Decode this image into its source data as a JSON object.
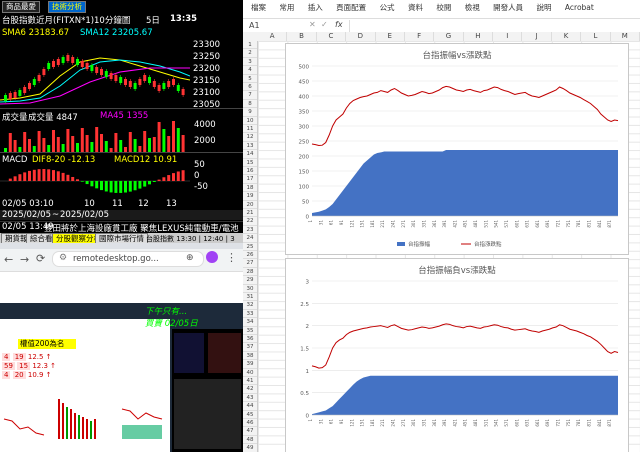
{
  "stock": {
    "tab1": "商品最愛",
    "tab2": "技術分析",
    "instrument": "台股指數近月(FITXN*1)",
    "interval": "10分鐘圖",
    "days": "5日",
    "time": "13:35",
    "sma6": "SMA6 23183.67",
    "sma12": "SMA12 23205.67",
    "price_ticks": [
      "23300",
      "23250",
      "23200",
      "23150",
      "23100",
      "23050"
    ],
    "vol_label": "成交量",
    "vol_value": "成交量 4847",
    "ma45": "MA45 1355",
    "vol_ticks": [
      "4000",
      "2000"
    ],
    "macd_label": "MACD",
    "dif": "DIF8-20 -12.13",
    "macd12": "MACD12 10.91",
    "macd_ticks": [
      "50",
      "0",
      "-50"
    ],
    "x_ticks": [
      "02/05 03:10",
      "10",
      "11",
      "12",
      "13"
    ],
    "date_from": "2025/02/05",
    "date_to": "2025/02/05",
    "news_time": "02/05 13:49",
    "news_text": "豐田將於上海設廠貫工廠 聚焦LEXUS純電動車/電池",
    "bottom_tabs": [
      "期貨報價",
      "綜合看盤",
      "分股觀察分析",
      "國際市場行情"
    ],
    "bottom_status": "台股指數 13:30 | 12:40 | 3"
  },
  "browser": {
    "url": "remotedesktop.go..."
  },
  "desktop": {
    "header": "權值200為名",
    "rows": [
      {
        "a": "4",
        "b": "19",
        "c": "12.5 ↑"
      },
      {
        "a": "59",
        "b": "15",
        "c": "12.3 ↑"
      },
      {
        "a": "4",
        "b": "20",
        "c": "10.9 ↑"
      }
    ],
    "overlay1": "下午只有...",
    "overlay2": "買賣 02/05日"
  },
  "excel": {
    "menu": [
      "檔案",
      "常用",
      "插入",
      "頁面配置",
      "公式",
      "資料",
      "校閱",
      "檢視",
      "開發人員",
      "說明",
      "Acrobat"
    ],
    "name_box": "A1",
    "formula_icon": "fx",
    "columns": [
      "A",
      "B",
      "C",
      "D",
      "E",
      "F",
      "G",
      "H",
      "I",
      "J",
      "K",
      "L",
      "M"
    ],
    "row_numbers": [
      "1",
      "2",
      "3",
      "4",
      "5",
      "6",
      "7",
      "8",
      "9",
      "10",
      "11",
      "12",
      "13",
      "14",
      "15",
      "16",
      "17",
      "18",
      "19",
      "20",
      "21",
      "22",
      "23",
      "24",
      "25",
      "26",
      "27",
      "28",
      "29",
      "30",
      "31",
      "32",
      "33",
      "34",
      "35",
      "36",
      "37",
      "38",
      "39",
      "40",
      "41",
      "42",
      "43",
      "44",
      "45",
      "46",
      "47",
      "48",
      "49"
    ],
    "accent": "#4472c4",
    "line_color": "#c00000"
  },
  "chart_data": [
    {
      "type": "line",
      "title": "台指振幅vs漲跌點",
      "ylim": [
        0,
        500
      ],
      "yticks": [
        0,
        50,
        100,
        150,
        200,
        250,
        300,
        350,
        400,
        450,
        500
      ],
      "series": [
        {
          "name": "台指振幅",
          "kind": "area",
          "values": [
            10,
            12,
            14,
            18,
            22,
            30,
            40,
            55,
            70,
            85,
            100,
            115,
            130,
            145,
            160,
            175,
            185,
            195,
            205,
            210,
            212,
            215,
            215,
            215,
            215,
            215,
            215,
            215,
            215,
            215,
            215,
            215,
            215,
            215,
            215,
            215,
            215,
            215,
            215,
            220,
            220,
            220,
            220,
            220,
            220,
            220,
            220,
            220,
            220,
            220,
            220,
            220,
            220,
            220,
            220,
            220,
            220,
            220,
            220,
            220,
            220,
            220,
            220,
            220,
            220,
            220,
            220,
            220,
            220,
            220,
            220,
            220,
            220,
            220,
            220,
            220,
            220,
            220,
            220,
            220,
            220,
            220,
            220,
            220,
            220,
            220,
            220,
            220,
            220,
            220
          ]
        },
        {
          "name": "台指漲跌點",
          "kind": "line",
          "values": [
            240,
            238,
            235,
            236,
            245,
            270,
            300,
            320,
            330,
            340,
            360,
            375,
            385,
            390,
            395,
            398,
            400,
            405,
            410,
            412,
            418,
            415,
            412,
            420,
            425,
            418,
            410,
            405,
            400,
            402,
            405,
            410,
            415,
            412,
            408,
            410,
            415,
            420,
            428,
            432,
            430,
            425,
            420,
            418,
            415,
            420,
            422,
            418,
            415,
            412,
            418,
            420,
            425,
            430,
            428,
            422,
            418,
            415,
            410,
            405,
            408,
            410,
            412,
            405,
            400,
            398,
            395,
            400,
            405,
            410,
            415,
            420,
            430,
            425,
            418,
            410,
            405,
            400,
            395,
            388,
            382,
            375,
            365,
            355,
            340,
            330,
            320,
            315,
            320,
            318
          ]
        }
      ],
      "legend": [
        "台指振幅",
        "台指漲跌點"
      ],
      "legend_position": "bottom"
    },
    {
      "type": "line",
      "title": "台指振幅負vs漲跌點",
      "ylim": [
        0,
        3
      ],
      "yticks": [
        0,
        0.5,
        1,
        1.5,
        2,
        2.5,
        3
      ],
      "ylabels": [
        "0",
        "0.5",
        "1",
        "1.5",
        "2",
        "2.5",
        "3"
      ],
      "series": [
        {
          "name": "台指振幅",
          "kind": "area",
          "values": [
            0.02,
            0.04,
            0.06,
            0.08,
            0.1,
            0.15,
            0.2,
            0.28,
            0.36,
            0.44,
            0.52,
            0.6,
            0.68,
            0.75,
            0.8,
            0.84,
            0.86,
            0.88,
            0.88,
            0.88,
            0.88,
            0.88,
            0.88,
            0.88,
            0.88,
            0.88,
            0.88,
            0.88,
            0.88,
            0.88,
            0.88,
            0.88,
            0.88,
            0.88,
            0.88,
            0.88,
            0.88,
            0.88,
            0.88,
            0.88,
            0.88,
            0.88,
            0.88,
            0.88,
            0.88,
            0.88,
            0.88,
            0.88,
            0.88,
            0.88,
            0.88,
            0.88,
            0.88,
            0.88,
            0.88,
            0.88,
            0.88,
            0.88,
            0.88,
            0.88,
            0.88,
            0.88,
            0.88,
            0.88,
            0.88,
            0.88,
            0.88,
            0.88,
            0.88,
            0.88,
            0.88,
            0.88,
            0.88,
            0.88,
            0.88,
            0.88,
            0.88,
            0.88,
            0.88,
            0.88,
            0.88,
            0.88,
            0.88,
            0.88,
            0.88,
            0.88,
            0.88,
            0.88,
            0.88,
            0.88
          ]
        },
        {
          "name": "台指漲跌點",
          "kind": "line",
          "values": [
            1.1,
            1.08,
            1.05,
            1.06,
            1.12,
            1.3,
            1.5,
            1.62,
            1.68,
            1.72,
            1.8,
            1.85,
            1.88,
            1.9,
            1.92,
            1.94,
            1.95,
            1.97,
            1.98,
            1.99,
            2.0,
            1.98,
            1.96,
            2.0,
            2.02,
            1.98,
            1.94,
            1.92,
            1.9,
            1.91,
            1.93,
            1.95,
            1.97,
            1.96,
            1.94,
            1.95,
            1.97,
            1.99,
            2.02,
            2.04,
            2.03,
            2.0,
            1.98,
            1.97,
            1.95,
            1.98,
            1.99,
            1.97,
            1.95,
            1.94,
            1.97,
            1.98,
            2.0,
            2.02,
            2.01,
            1.98,
            1.96,
            1.95,
            1.92,
            1.9,
            1.91,
            1.92,
            1.93,
            1.9,
            1.88,
            1.87,
            1.85,
            1.88,
            1.9,
            1.92,
            1.95,
            1.97,
            2.02,
            2.0,
            1.96,
            1.92,
            1.9,
            1.88,
            1.85,
            1.82,
            1.78,
            1.75,
            1.7,
            1.65,
            1.58,
            1.5,
            1.42,
            1.38,
            1.42,
            1.4
          ]
        }
      ]
    }
  ]
}
